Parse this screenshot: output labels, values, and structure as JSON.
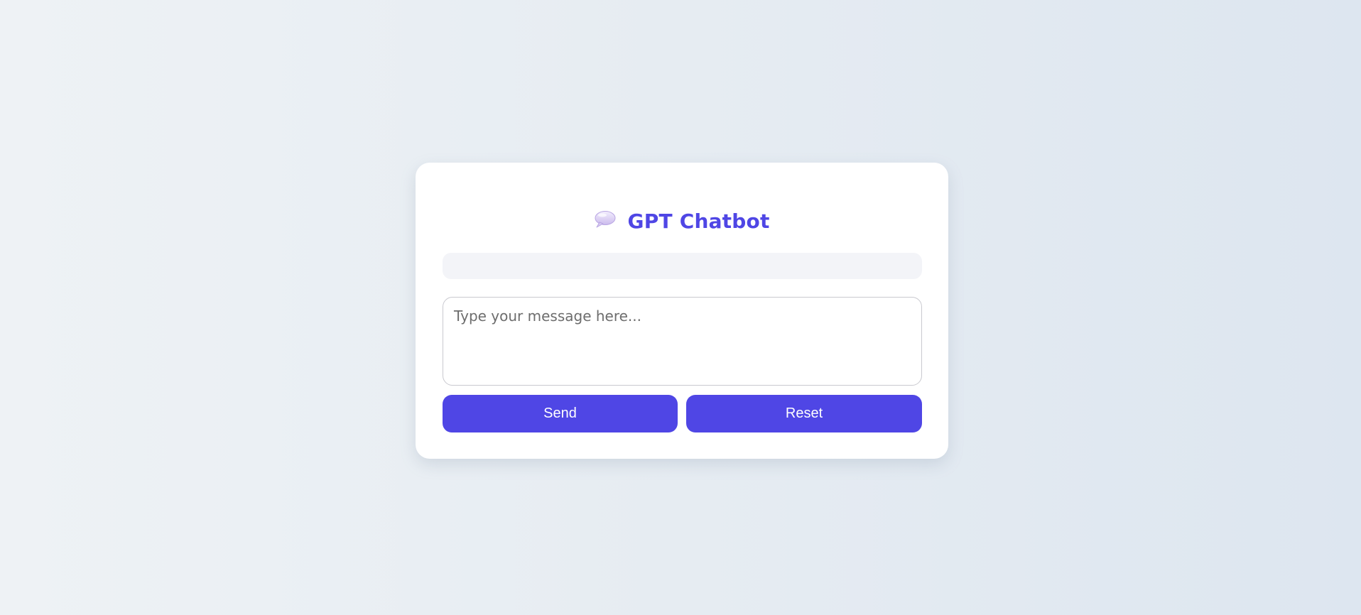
{
  "app": {
    "title": "GPT Chatbot",
    "title_icon": "speech-bubble-icon"
  },
  "chat": {
    "messages": []
  },
  "input": {
    "value": "",
    "placeholder": "Type your message here..."
  },
  "buttons": {
    "send_label": "Send",
    "reset_label": "Reset"
  },
  "colors": {
    "accent": "#4f46e5",
    "card": "#ffffff",
    "chat_log_bg": "#f3f4f8"
  }
}
